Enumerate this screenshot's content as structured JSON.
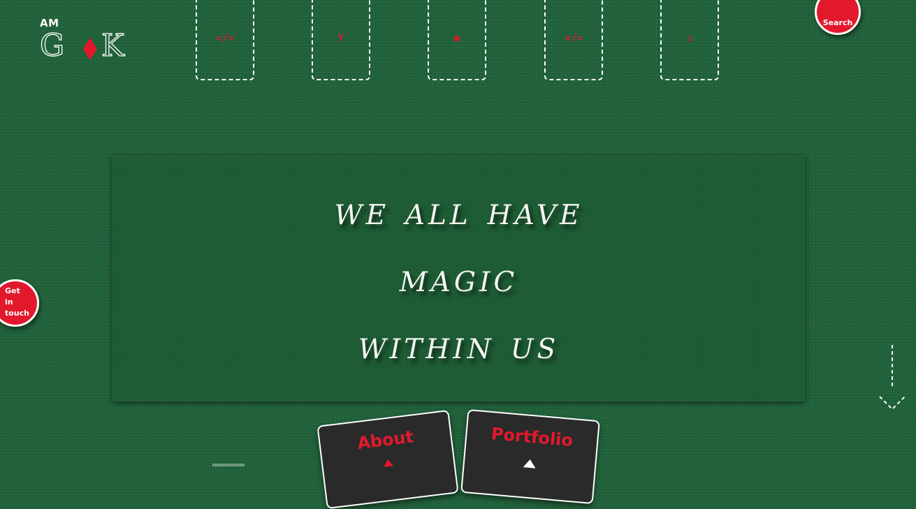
{
  "logo": {
    "prefix": "AM",
    "letters": "G K",
    "diamond_color": "#e2192d"
  },
  "nav_slots": [
    {
      "icon": "code-icon",
      "glyph": "</>"
    },
    {
      "icon": "git-branch-icon",
      "glyph": "Y"
    },
    {
      "icon": "id-card-icon",
      "glyph": "▣"
    },
    {
      "icon": "code-icon",
      "glyph": "</>"
    },
    {
      "icon": "anchor-icon",
      "glyph": "⚓"
    }
  ],
  "buttons": {
    "search_label": "Search",
    "touch_label_lines": [
      "Get",
      "in",
      "touch"
    ]
  },
  "hero": {
    "lines": [
      "We all have",
      "Magic",
      "within us"
    ]
  },
  "cards": {
    "about_label": "About",
    "portfolio_label": "Portfolio"
  },
  "colors": {
    "felt": "#21633b",
    "accent_red": "#e2192d",
    "card_dark": "#2a2a2a",
    "text_light": "#f4f4f0"
  }
}
